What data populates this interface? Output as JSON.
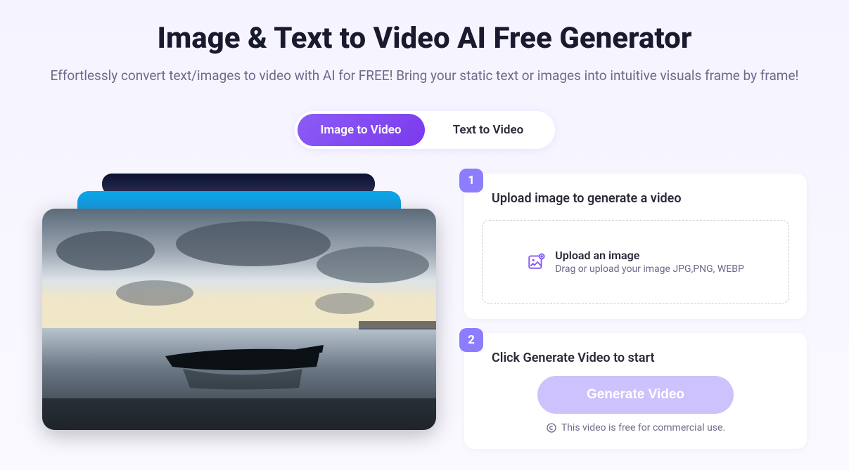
{
  "hero": {
    "title": "Image & Text to Video AI Free Generator",
    "subtitle": "Effortlessly convert text/images to video with AI for FREE! Bring your static text or images into intuitive visuals frame by frame!"
  },
  "tabs": {
    "image": "Image to Video",
    "text": "Text to Video"
  },
  "step1": {
    "badge": "1",
    "title": "Upload image to generate a video",
    "upload_title": "Upload an image",
    "upload_sub": "Drag or upload your image JPG,PNG, WEBP"
  },
  "step2": {
    "badge": "2",
    "title": "Click Generate Video to start",
    "button": "Generate Video",
    "license": "This video is free for commercial use."
  }
}
